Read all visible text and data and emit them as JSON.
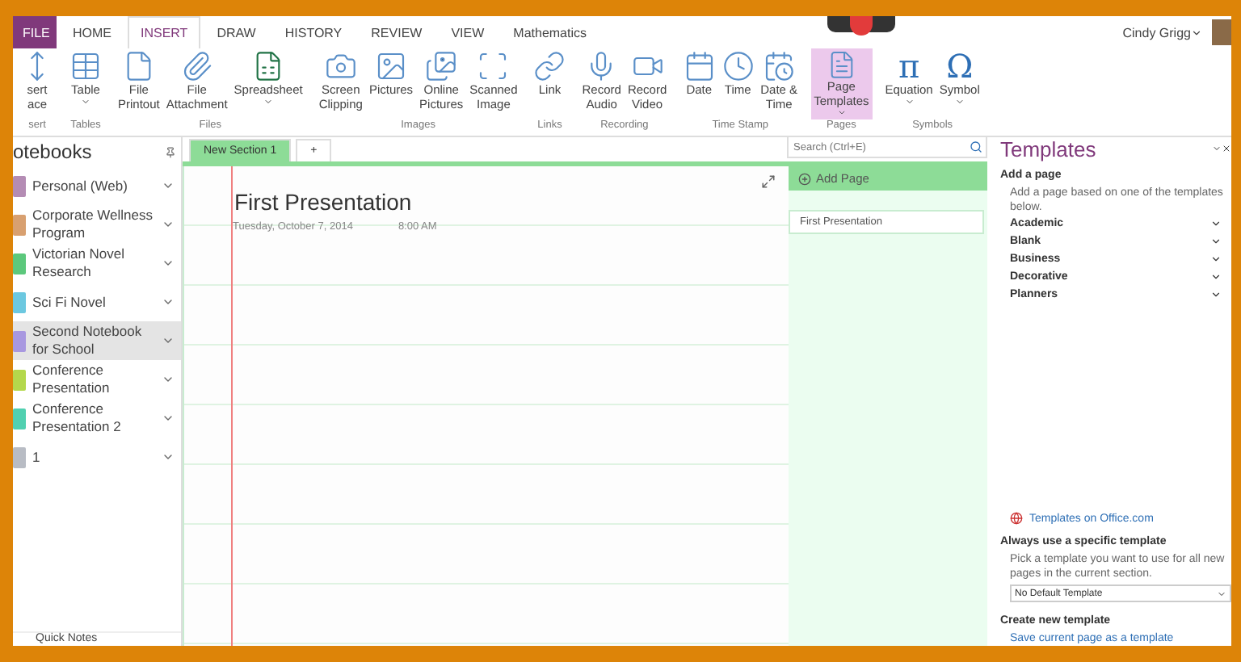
{
  "ribbon_tabs": [
    {
      "label": "FILE",
      "kind": "file",
      "selected": false
    },
    {
      "label": "HOME",
      "kind": "tab",
      "selected": false
    },
    {
      "label": "INSERT",
      "kind": "tab",
      "selected": true
    },
    {
      "label": "DRAW",
      "kind": "tab",
      "selected": false
    },
    {
      "label": "HISTORY",
      "kind": "tab",
      "selected": false
    },
    {
      "label": "REVIEW",
      "kind": "tab",
      "selected": false
    },
    {
      "label": "VIEW",
      "kind": "tab",
      "selected": false
    },
    {
      "label": "Mathematics",
      "kind": "tab",
      "selected": false
    }
  ],
  "user": {
    "name": "Cindy Grigg"
  },
  "ribbon_groups": [
    {
      "label": "sert",
      "buttons": [
        {
          "label": "sert\nace",
          "dropdown": false,
          "selected": false
        }
      ]
    },
    {
      "label": "Tables",
      "buttons": [
        {
          "label": "Table",
          "dropdown": true,
          "selected": false
        }
      ]
    },
    {
      "label": "Files",
      "buttons": [
        {
          "label": "File\nPrintout",
          "dropdown": false,
          "selected": false
        },
        {
          "label": "File\nAttachment",
          "dropdown": false,
          "selected": false
        },
        {
          "label": "Spreadsheet",
          "dropdown": true,
          "selected": false
        }
      ]
    },
    {
      "label": "Images",
      "buttons": [
        {
          "label": "Screen\nClipping",
          "dropdown": false,
          "selected": false
        },
        {
          "label": "Pictures",
          "dropdown": false,
          "selected": false
        },
        {
          "label": "Online\nPictures",
          "dropdown": false,
          "selected": false
        },
        {
          "label": "Scanned\nImage",
          "dropdown": false,
          "selected": false
        }
      ]
    },
    {
      "label": "Links",
      "buttons": [
        {
          "label": "Link",
          "dropdown": false,
          "selected": false
        }
      ]
    },
    {
      "label": "Recording",
      "buttons": [
        {
          "label": "Record\nAudio",
          "dropdown": false,
          "selected": false
        },
        {
          "label": "Record\nVideo",
          "dropdown": false,
          "selected": false
        }
      ]
    },
    {
      "label": "Time Stamp",
      "buttons": [
        {
          "label": "Date",
          "dropdown": false,
          "selected": false
        },
        {
          "label": "Time",
          "dropdown": false,
          "selected": false
        },
        {
          "label": "Date &\nTime",
          "dropdown": false,
          "selected": false
        }
      ]
    },
    {
      "label": "Pages",
      "buttons": [
        {
          "label": "Page\nTemplates",
          "dropdown": true,
          "selected": true
        }
      ]
    },
    {
      "label": "Symbols",
      "buttons": [
        {
          "label": "Equation",
          "glyph": "π",
          "dropdown": true,
          "selected": false
        },
        {
          "label": "Symbol",
          "glyph": "Ω",
          "dropdown": true,
          "selected": false
        }
      ]
    }
  ],
  "notebooks": {
    "title": "otebooks",
    "items": [
      {
        "name": "Personal (Web)",
        "color": "#b48cb4",
        "selected": false
      },
      {
        "name": "Corporate Wellness Program",
        "color": "#d8a070",
        "selected": false
      },
      {
        "name": "Victorian Novel Research",
        "color": "#5cc87c",
        "selected": false
      },
      {
        "name": "Sci Fi Novel",
        "color": "#6cc8e0",
        "selected": false
      },
      {
        "name": "Second Notebook for School",
        "color": "#a898e0",
        "selected": true
      },
      {
        "name": "Conference Presentation",
        "color": "#b4d84c",
        "selected": false
      },
      {
        "name": "Conference Presentation 2",
        "color": "#50d0b0",
        "selected": false
      },
      {
        "name": "1",
        "color": "#b8bcc4",
        "selected": false
      }
    ],
    "footer": "Quick Notes"
  },
  "sections": [
    {
      "label": "New Section 1",
      "selected": true
    },
    {
      "label": "+",
      "selected": false
    }
  ],
  "search": {
    "placeholder": "Search (Ctrl+E)"
  },
  "page": {
    "title": "First Presentation",
    "date": "Tuesday, October 7, 2014",
    "time": "8:00 AM"
  },
  "page_list": {
    "add": "Add Page",
    "pages": [
      {
        "title": "First Presentation",
        "selected": true
      }
    ]
  },
  "templates": {
    "title": "Templates",
    "add_heading": "Add a page",
    "add_text": "Add a page based on one of the templates below.",
    "categories": [
      "Academic",
      "Blank",
      "Business",
      "Decorative",
      "Planners"
    ],
    "office_link": "Templates on Office.com",
    "default_heading": "Always use a specific template",
    "default_text": "Pick a template you want to use for all new pages in the current section.",
    "default_value": "No Default Template",
    "create_heading": "Create new template",
    "save_link": "Save current page as a template"
  }
}
